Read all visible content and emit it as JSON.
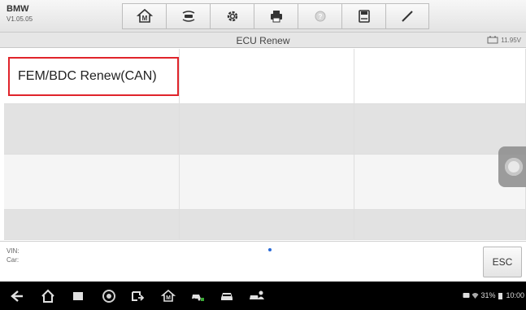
{
  "app": {
    "name": "BMW",
    "version": "V1.05.05"
  },
  "toolbar": {
    "buttons": [
      {
        "icon": "home-icon"
      },
      {
        "icon": "vehicle-swap-icon"
      },
      {
        "icon": "gear-icon"
      },
      {
        "icon": "printer-icon"
      },
      {
        "icon": "help-icon"
      },
      {
        "icon": "save-icon"
      },
      {
        "icon": "pen-icon"
      }
    ]
  },
  "screen": {
    "title": "ECU Renew",
    "battery_voltage": "11.95V"
  },
  "menu": {
    "items": [
      {
        "label": "FEM/BDC Renew(CAN)"
      }
    ]
  },
  "info": {
    "vin_label": "VIN:",
    "car_label": "Car:"
  },
  "actions": {
    "esc_label": "ESC"
  },
  "status": {
    "battery_percent": "31%",
    "time": "10:00"
  },
  "colors": {
    "selection_border": "#e0242b",
    "nav_bar": "#000000"
  }
}
